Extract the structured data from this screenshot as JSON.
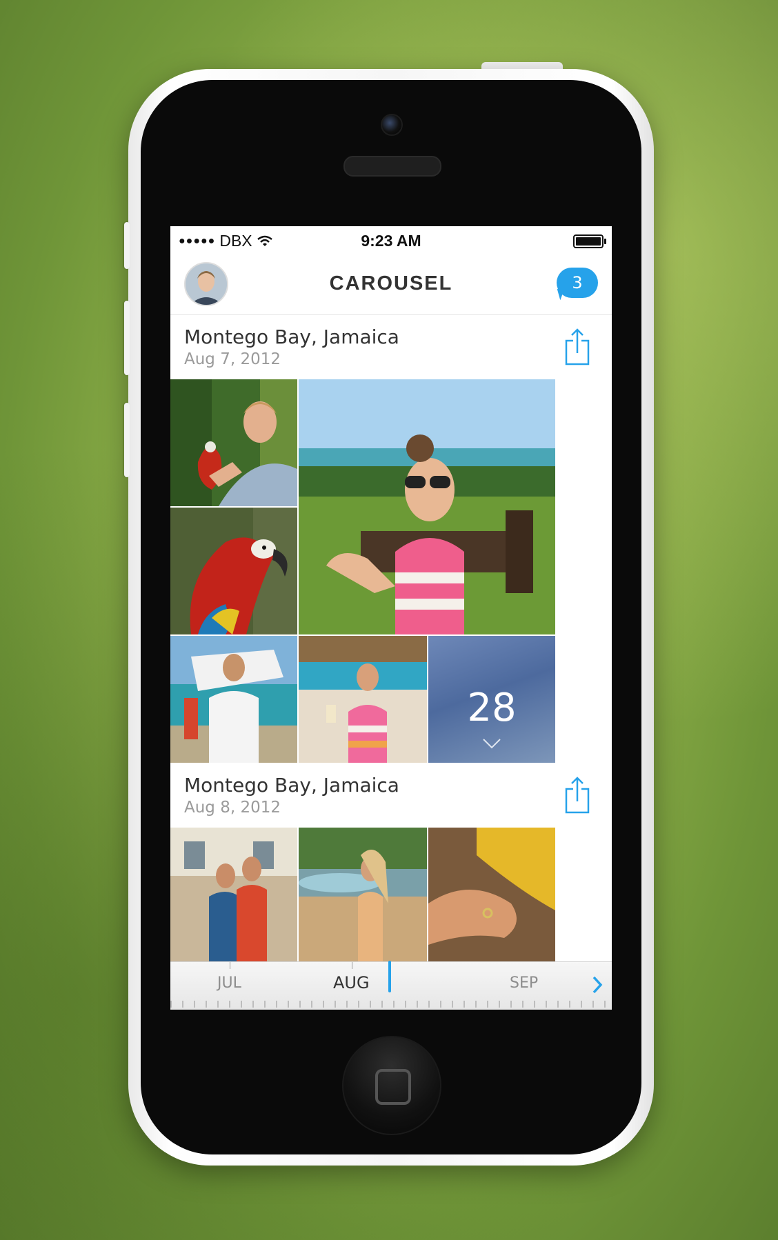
{
  "status_bar": {
    "signal": "●●●●●",
    "carrier": "DBX",
    "time": "9:23 AM",
    "battery_level": 1.0
  },
  "navbar": {
    "title": "CAROUSEL",
    "notification_count": "3"
  },
  "sections": [
    {
      "place": "Montego Bay, Jamaica",
      "date": "Aug 7, 2012",
      "more_count": "28"
    },
    {
      "place": "Montego Bay, Jamaica",
      "date": "Aug 8, 2012"
    }
  ],
  "timeline": {
    "months": [
      "JUL",
      "AUG",
      "SEP"
    ],
    "active_month": "AUG"
  },
  "colors": {
    "accent": "#26a2ea",
    "background_green": "#8fb04a",
    "title": "#333333",
    "date_gray": "#9a9a9a"
  },
  "icons": [
    "wifi-icon",
    "battery-icon",
    "share-icon",
    "chevron-down-icon",
    "chevron-right-icon",
    "chat-bubble-icon"
  ]
}
